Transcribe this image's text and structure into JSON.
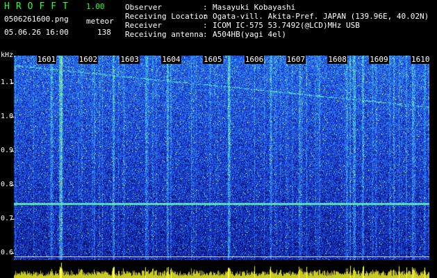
{
  "header": {
    "app_name": "HROFFT",
    "app_version": "1.00",
    "filename": "0506261600.png",
    "event_type": "meteor",
    "datetime": "05.06.26 16:00",
    "event_count": "138"
  },
  "info": {
    "observer_label": "Observer",
    "observer_value": "Masayuki Kobayashi",
    "location_label": "Receiving Location",
    "location_value": "Ogata-vill. Akita-Pref. JAPAN (139.96E, 40.02N)",
    "receiver_label": "Receiver",
    "receiver_value": "ICOM IC-575 53.7492(@LCD)MHz USB",
    "antenna_label": "Receiving antenna",
    "antenna_value": "A504HB(yagi 4el)",
    "separator": ":"
  },
  "chart_data": {
    "type": "heatmap",
    "ylabel": "kHz",
    "y_ticks": [
      "1.1",
      "1.0",
      "0.9",
      "0.8",
      "0.7",
      "0.6"
    ],
    "time_ticks": [
      "1601",
      "1602",
      "1603",
      "1604",
      "1605",
      "1606",
      "1607",
      "1608",
      "1609",
      "1610"
    ],
    "ylim": [
      0.58,
      1.18
    ],
    "xlim_minutes": [
      0,
      10
    ],
    "carrier_khz": 0.745,
    "colormap": [
      "#000050",
      "#0a1c9a",
      "#1f46d8",
      "#2e78ff",
      "#40c8e8",
      "#7dff7d",
      "#ffff40"
    ]
  }
}
